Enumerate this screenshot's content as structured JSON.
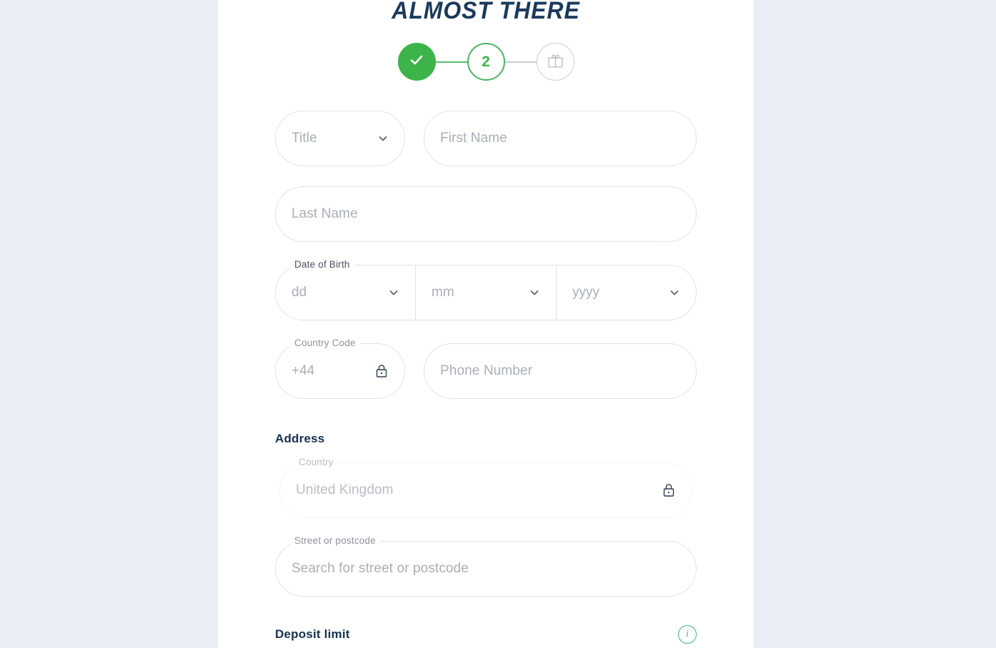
{
  "headline": "ALMOST THERE",
  "stepper": {
    "steps": [
      {
        "state": "done",
        "icon": "check-icon",
        "label": ""
      },
      {
        "state": "current",
        "icon": "",
        "label": "2"
      },
      {
        "state": "future",
        "icon": "gift-icon",
        "label": ""
      }
    ]
  },
  "form": {
    "title_field": {
      "placeholder": "Title",
      "icon": "chevron-down-icon"
    },
    "first_name": {
      "placeholder": "First Name"
    },
    "last_name": {
      "placeholder": "Last Name"
    },
    "date_of_birth": {
      "label": "Date of Birth",
      "day": {
        "placeholder": "dd",
        "icon": "chevron-down-icon"
      },
      "month": {
        "placeholder": "mm",
        "icon": "chevron-down-icon"
      },
      "year": {
        "placeholder": "yyyy",
        "icon": "chevron-down-icon"
      }
    },
    "country_code": {
      "label": "Country Code",
      "value": "+44",
      "icon": "lock-icon"
    },
    "phone_number": {
      "placeholder": "Phone Number"
    },
    "address_heading": "Address",
    "country": {
      "label": "Country",
      "value": "United Kingdom",
      "icon": "lock-icon"
    },
    "street": {
      "label": "Street or postcode",
      "placeholder": "Search for street or postcode"
    },
    "deposit_limit": {
      "label": "Deposit limit",
      "icon": "info-icon",
      "info_char": "i"
    }
  },
  "colors": {
    "page_background": "#eaedf5",
    "card_background": "#ffffff",
    "headline": "#1b3a5c",
    "step_done": "#3cb44a",
    "step_current": "#4ab561",
    "step_future": "#c9ccd4",
    "field_border": "#dfe2e8",
    "placeholder": "#a9aeb7",
    "heading": "#16314f",
    "info_accent": "#35b3a0"
  }
}
